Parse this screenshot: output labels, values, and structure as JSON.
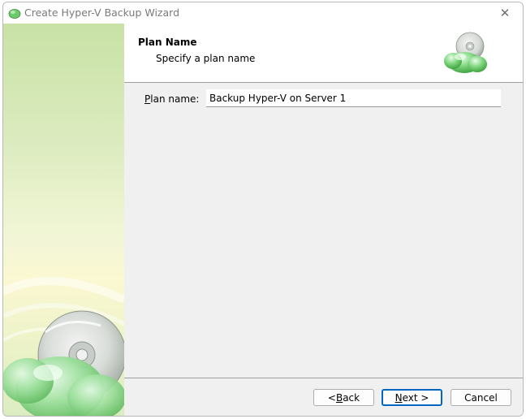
{
  "window": {
    "title": "Create Hyper-V Backup Wizard",
    "app_icon": "cloud-backup-icon",
    "close_glyph": "✕"
  },
  "header": {
    "title": "Plan Name",
    "subtitle": "Specify a plan name",
    "icon": "cloud-cd-icon"
  },
  "form": {
    "plan_name_label": "Plan name:",
    "plan_name_value": "Backup Hyper-V on Server 1"
  },
  "footer": {
    "back_label": "< Back",
    "next_label": "Next >",
    "cancel_label": "Cancel"
  },
  "colors": {
    "accent": "#0067c0",
    "cloud_green": "#5cc85c",
    "sidebar_green": "#c8e2a6"
  }
}
